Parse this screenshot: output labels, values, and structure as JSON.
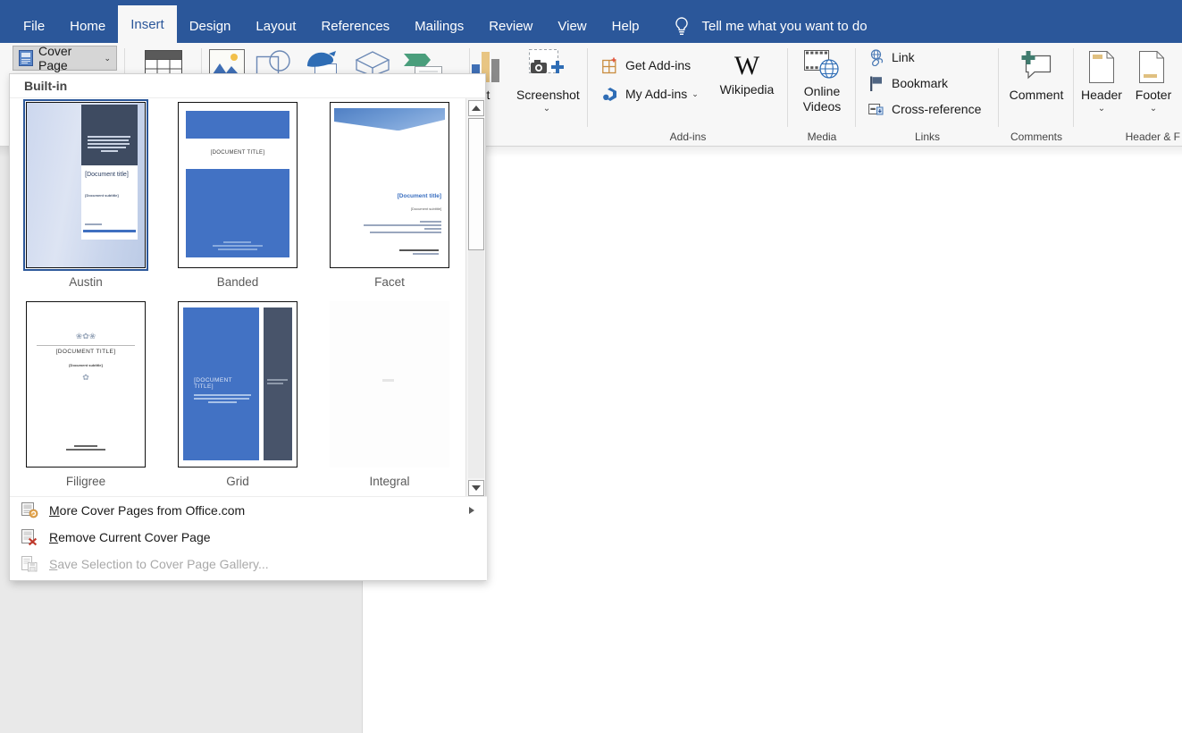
{
  "window": {
    "accent_color": "#2b579a",
    "ribbon_bg": "#f7f7f7",
    "canvas_bg": "#e9e9e9"
  },
  "tabs": [
    {
      "id": "file",
      "label": "File",
      "active": false
    },
    {
      "id": "home",
      "label": "Home",
      "active": false
    },
    {
      "id": "insert",
      "label": "Insert",
      "active": true
    },
    {
      "id": "design",
      "label": "Design",
      "active": false
    },
    {
      "id": "layout",
      "label": "Layout",
      "active": false
    },
    {
      "id": "references",
      "label": "References",
      "active": false
    },
    {
      "id": "mailings",
      "label": "Mailings",
      "active": false
    },
    {
      "id": "review",
      "label": "Review",
      "active": false
    },
    {
      "id": "view",
      "label": "View",
      "active": false
    },
    {
      "id": "help",
      "label": "Help",
      "active": false
    }
  ],
  "tellme": {
    "icon": "lightbulb-icon",
    "placeholder": "Tell me what you want to do"
  },
  "ribbon": {
    "cover_page_button": {
      "label": "Cover Page",
      "icon": "cover-page-icon",
      "caret": "⌄",
      "state": "open"
    },
    "partial_icons": [
      {
        "name": "table-icon"
      },
      {
        "name": "pictures-icon"
      },
      {
        "name": "shapes-icon"
      },
      {
        "name": "icons-3d-icon"
      },
      {
        "name": "3d-models-icon"
      },
      {
        "name": "smartart-icon"
      },
      {
        "name": "chart-icon"
      }
    ],
    "chart_label_partial": "art",
    "screenshot": {
      "label": "Screenshot",
      "icon": "screenshot-icon",
      "caret": "⌄"
    },
    "groups": [
      {
        "id": "addins",
        "label": "Add-ins",
        "items": [
          {
            "id": "get-add-ins",
            "label": "Get Add-ins",
            "icon": "get-addins-icon"
          },
          {
            "id": "my-add-ins",
            "label": "My Add-ins",
            "icon": "my-addins-icon",
            "caret": "⌄"
          },
          {
            "id": "wikipedia",
            "label": "Wikipedia",
            "icon": "wikipedia-icon"
          }
        ]
      },
      {
        "id": "media",
        "label": "Media",
        "items": [
          {
            "id": "online-videos",
            "label_line1": "Online",
            "label_line2": "Videos",
            "icon": "online-videos-icon"
          }
        ]
      },
      {
        "id": "links",
        "label": "Links",
        "items": [
          {
            "id": "link",
            "label": "Link",
            "icon": "link-icon"
          },
          {
            "id": "bookmark",
            "label": "Bookmark",
            "icon": "bookmark-flag-icon"
          },
          {
            "id": "cross-reference",
            "label": "Cross-reference",
            "icon": "cross-reference-icon"
          }
        ]
      },
      {
        "id": "comments",
        "label": "Comments",
        "items": [
          {
            "id": "comment",
            "label": "Comment",
            "icon": "new-comment-icon"
          }
        ]
      },
      {
        "id": "header-footer",
        "label": "Header & F",
        "items": [
          {
            "id": "header",
            "label": "Header",
            "icon": "header-icon",
            "caret": "⌄"
          },
          {
            "id": "footer",
            "label": "Footer",
            "icon": "footer-icon",
            "caret": "⌄"
          }
        ]
      }
    ]
  },
  "dropdown": {
    "header": "Built-in",
    "gallery": [
      {
        "id": "austin",
        "caption": "Austin",
        "selected": true,
        "style": "austin",
        "title_text": "[Document title]",
        "subtitle_text": "[Document subtitle]"
      },
      {
        "id": "banded",
        "caption": "Banded",
        "selected": false,
        "style": "banded",
        "title_text": "[DOCUMENT TITLE]",
        "subtitle_text": "[Date]\n[Company address]"
      },
      {
        "id": "facet",
        "caption": "Facet",
        "selected": false,
        "style": "facet",
        "title_text": "[Document title]",
        "subtitle_text": "[Document subtitle]"
      },
      {
        "id": "filigree",
        "caption": "Filigree",
        "selected": false,
        "style": "filigree",
        "title_text": "[DOCUMENT TITLE]",
        "subtitle_text": "[Document subtitle]"
      },
      {
        "id": "grid",
        "caption": "Grid",
        "selected": false,
        "style": "grid",
        "title_text": "[DOCUMENT TITLE]",
        "subtitle_text": "[Document subtitle]"
      },
      {
        "id": "integral",
        "caption": "Integral",
        "selected": false,
        "style": "blank",
        "title_text": "",
        "subtitle_text": ""
      }
    ],
    "scrollbar": {
      "up_arrow": "▲",
      "down_arrow": "▼",
      "thumb_position": "top"
    },
    "commands": [
      {
        "id": "more-cover-pages",
        "label_prefix": "M",
        "label_rest": "ore Cover Pages from Office.com",
        "icon": "more-from-office-icon",
        "disabled": false,
        "has_submenu": true
      },
      {
        "id": "remove-current-cover-page",
        "label_prefix": "R",
        "label_rest": "emove Current Cover Page",
        "icon": "remove-cover-page-icon",
        "disabled": false,
        "has_submenu": false
      },
      {
        "id": "save-selection-to-gallery",
        "label_prefix": "S",
        "label_rest": "ave Selection to Cover Page Gallery...",
        "icon": "save-to-gallery-icon",
        "disabled": true,
        "has_submenu": false
      }
    ]
  }
}
